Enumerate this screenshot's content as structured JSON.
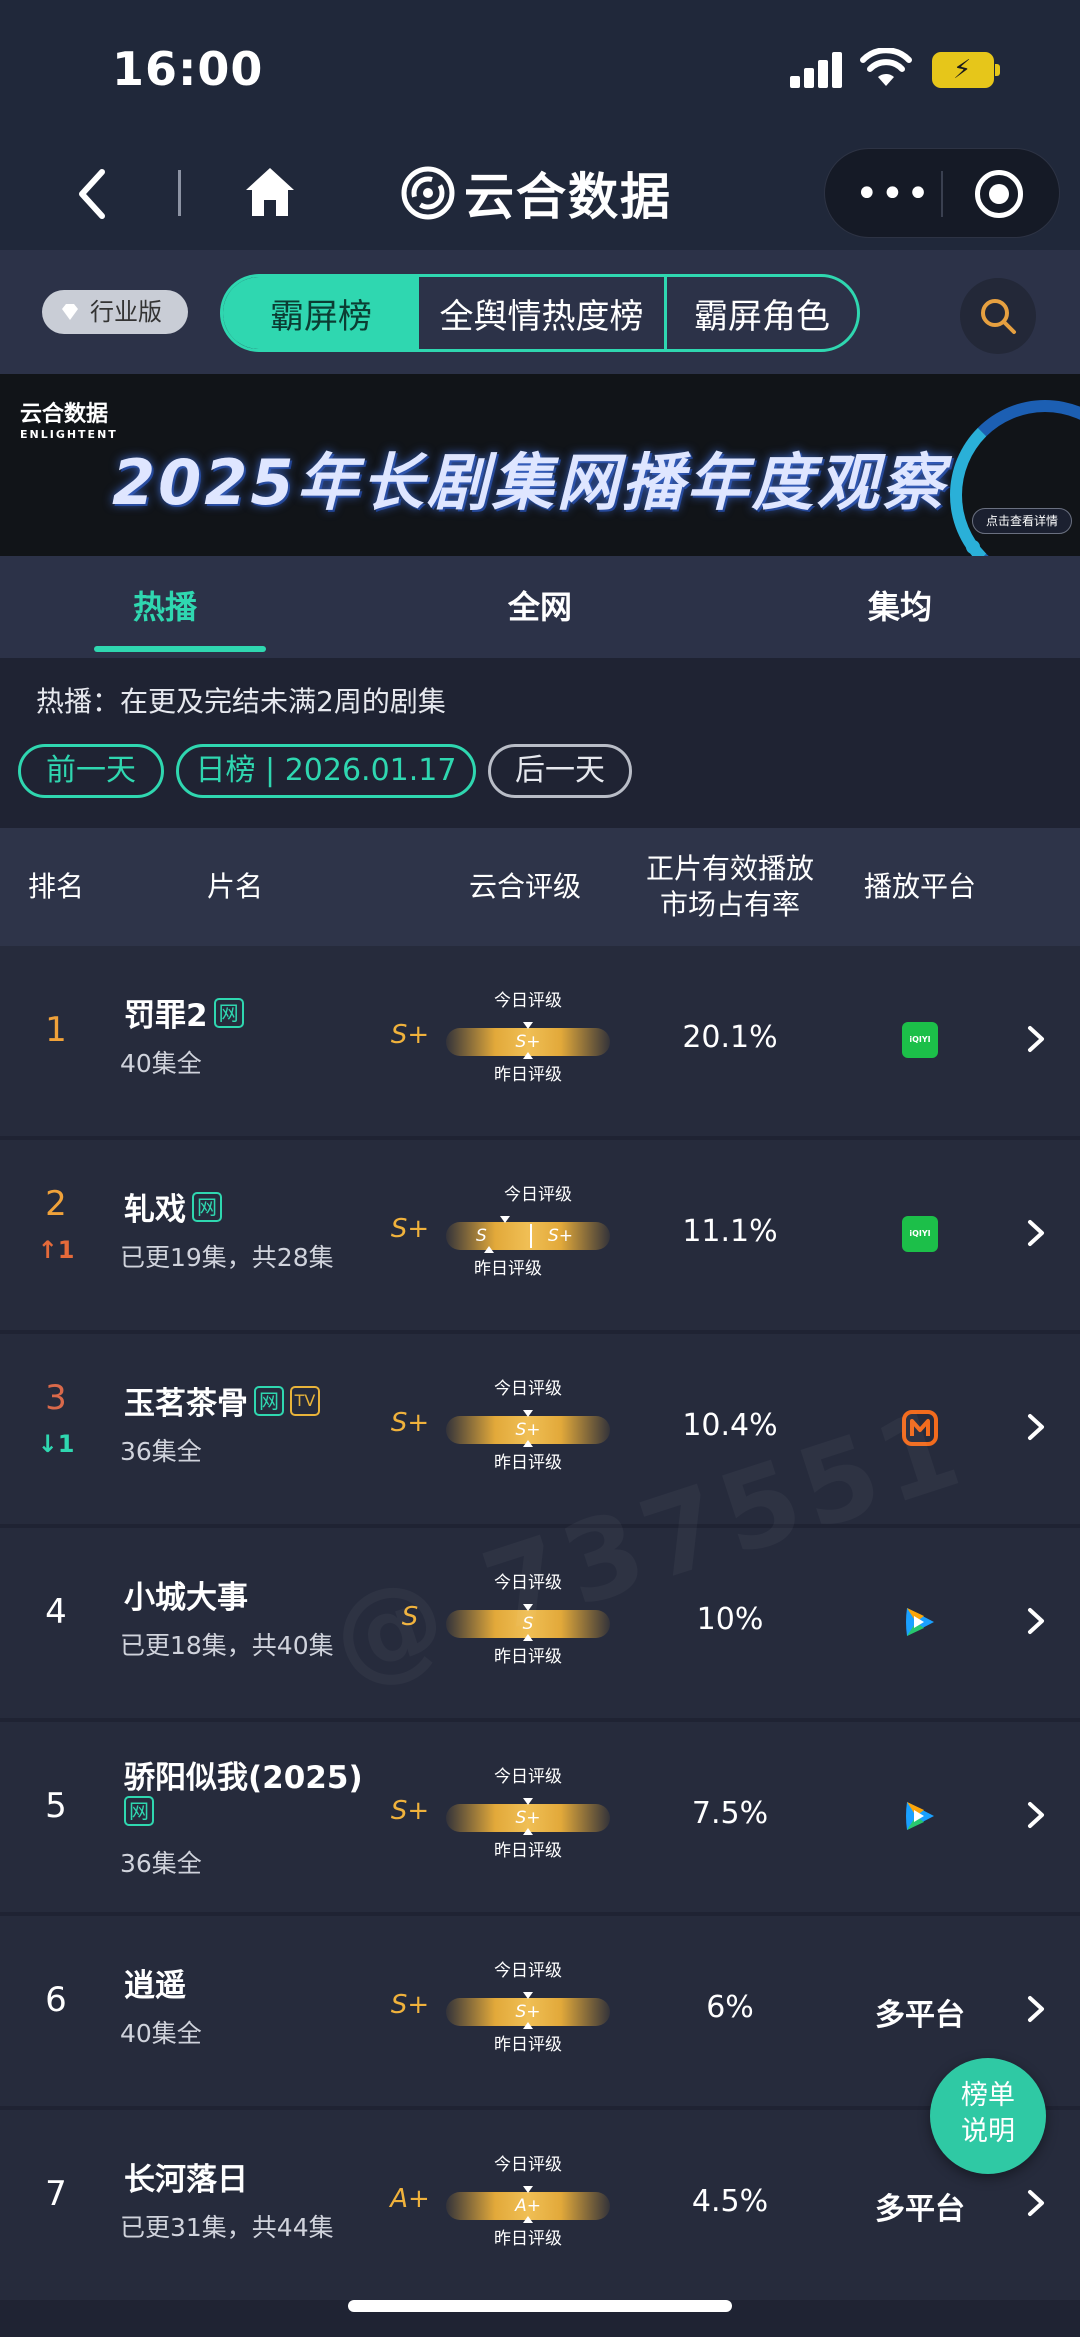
{
  "status": {
    "time": "16:00"
  },
  "nav": {
    "title": "云合数据",
    "more": "•••"
  },
  "segment": {
    "badge": "行业版",
    "tabs": [
      "霸屏榜",
      "全舆情热度榜",
      "霸屏角色"
    ]
  },
  "banner": {
    "logo": "云合数据",
    "logo_sub": "ENLIGHTENT",
    "title": "2025年长剧集网播年度观察",
    "button": "点击查看详情"
  },
  "tabs": [
    "热播",
    "全网",
    "集均"
  ],
  "description": "热播：在更及完结未满2周的剧集",
  "date_nav": {
    "prev": "前一天",
    "current": "日榜 | 2026.01.17",
    "next": "后一天"
  },
  "table": {
    "headers": {
      "rank": "排名",
      "title": "片名",
      "grade": "云合评级",
      "share_l1": "正片有效播放",
      "share_l2": "市场占有率",
      "platform": "播放平台"
    },
    "today_label": "今日评级",
    "yesterday_label": "昨日评级",
    "rows": [
      {
        "rank": "1",
        "rank_color": "#f0a23a",
        "trend": "",
        "title": "罚罪2",
        "tags": [
          "网"
        ],
        "eps": "40集全",
        "grade": "S+",
        "bar_today": "S+",
        "bar_yesterday": "",
        "share": "20.1%",
        "platform": "iqiyi",
        "platform_text": "iQIYI"
      },
      {
        "rank": "2",
        "rank_color": "#f0a23a",
        "trend": "↑1",
        "trend_dir": "up",
        "title": "轧戏",
        "tags": [
          "网"
        ],
        "eps": "已更19集，共28集",
        "grade": "S+",
        "bar_today": "S+",
        "bar_yesterday": "S",
        "share": "11.1%",
        "platform": "iqiyi",
        "platform_text": "iQIYI"
      },
      {
        "rank": "3",
        "rank_color": "#d9694a",
        "trend": "↓1",
        "trend_dir": "down",
        "title": "玉茗茶骨",
        "tags": [
          "网",
          "TV"
        ],
        "eps": "36集全",
        "grade": "S+",
        "bar_today": "S+",
        "bar_yesterday": "",
        "share": "10.4%",
        "platform": "mgtv",
        "platform_text": ""
      },
      {
        "rank": "4",
        "rank_color": "#ffffff",
        "trend": "",
        "title": "小城大事",
        "tags": [],
        "eps": "已更18集，共40集",
        "grade": "S",
        "bar_today": "S",
        "bar_yesterday": "",
        "share": "10%",
        "platform": "tencent",
        "platform_text": ""
      },
      {
        "rank": "5",
        "rank_color": "#ffffff",
        "trend": "",
        "title": "骄阳似我(2025)",
        "tags": [
          "网"
        ],
        "eps": "36集全",
        "grade": "S+",
        "bar_today": "S+",
        "bar_yesterday": "",
        "share": "7.5%",
        "platform": "tencent",
        "platform_text": ""
      },
      {
        "rank": "6",
        "rank_color": "#ffffff",
        "trend": "",
        "title": "逍遥",
        "tags": [],
        "eps": "40集全",
        "grade": "S+",
        "bar_today": "S+",
        "bar_yesterday": "",
        "share": "6%",
        "platform": "multi",
        "platform_text": "多平台"
      },
      {
        "rank": "7",
        "rank_color": "#ffffff",
        "trend": "",
        "title": "长河落日",
        "tags": [],
        "eps": "已更31集，共44集",
        "grade": "A+",
        "bar_today": "A+",
        "bar_yesterday": "",
        "share": "4.5%",
        "platform": "multi",
        "platform_text": "多平台"
      }
    ]
  },
  "float_button": {
    "line1": "榜单",
    "line2": "说明"
  },
  "watermark": "@ 737551"
}
